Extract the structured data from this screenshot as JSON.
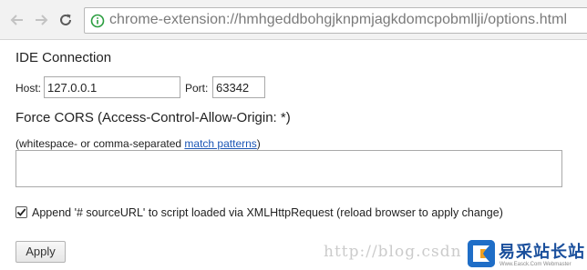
{
  "browser": {
    "url": "chrome-extension://hmhgeddbohgjknpmjagkdomcpobmllji/options.html",
    "url_color": "#7a7a7a",
    "secure_icon_color": "#2a9d3f"
  },
  "ide_connection": {
    "title": "IDE Connection",
    "host_label": "Host:",
    "host_value": "127.0.0.1",
    "port_label": "Port:",
    "port_value": "63342"
  },
  "cors": {
    "title": "Force CORS (Access-Control-Allow-Origin: *)",
    "hint_prefix": "(whitespace- or comma-separated ",
    "hint_link": "match patterns",
    "hint_suffix": ")",
    "textarea_value": ""
  },
  "append_option": {
    "checked": true,
    "label": "Append '# sourceURL' to script loaded via XMLHttpRequest (reload browser to apply change)"
  },
  "apply_button": {
    "label": "Apply"
  },
  "watermark": {
    "url_text": "http://blog.csdn",
    "brand": "易采站长站",
    "brand_sub": "Www.Easck.Com Webmaster"
  },
  "colors": {
    "link": "#1a55b5",
    "brand_blue": "#1f6ec7"
  }
}
